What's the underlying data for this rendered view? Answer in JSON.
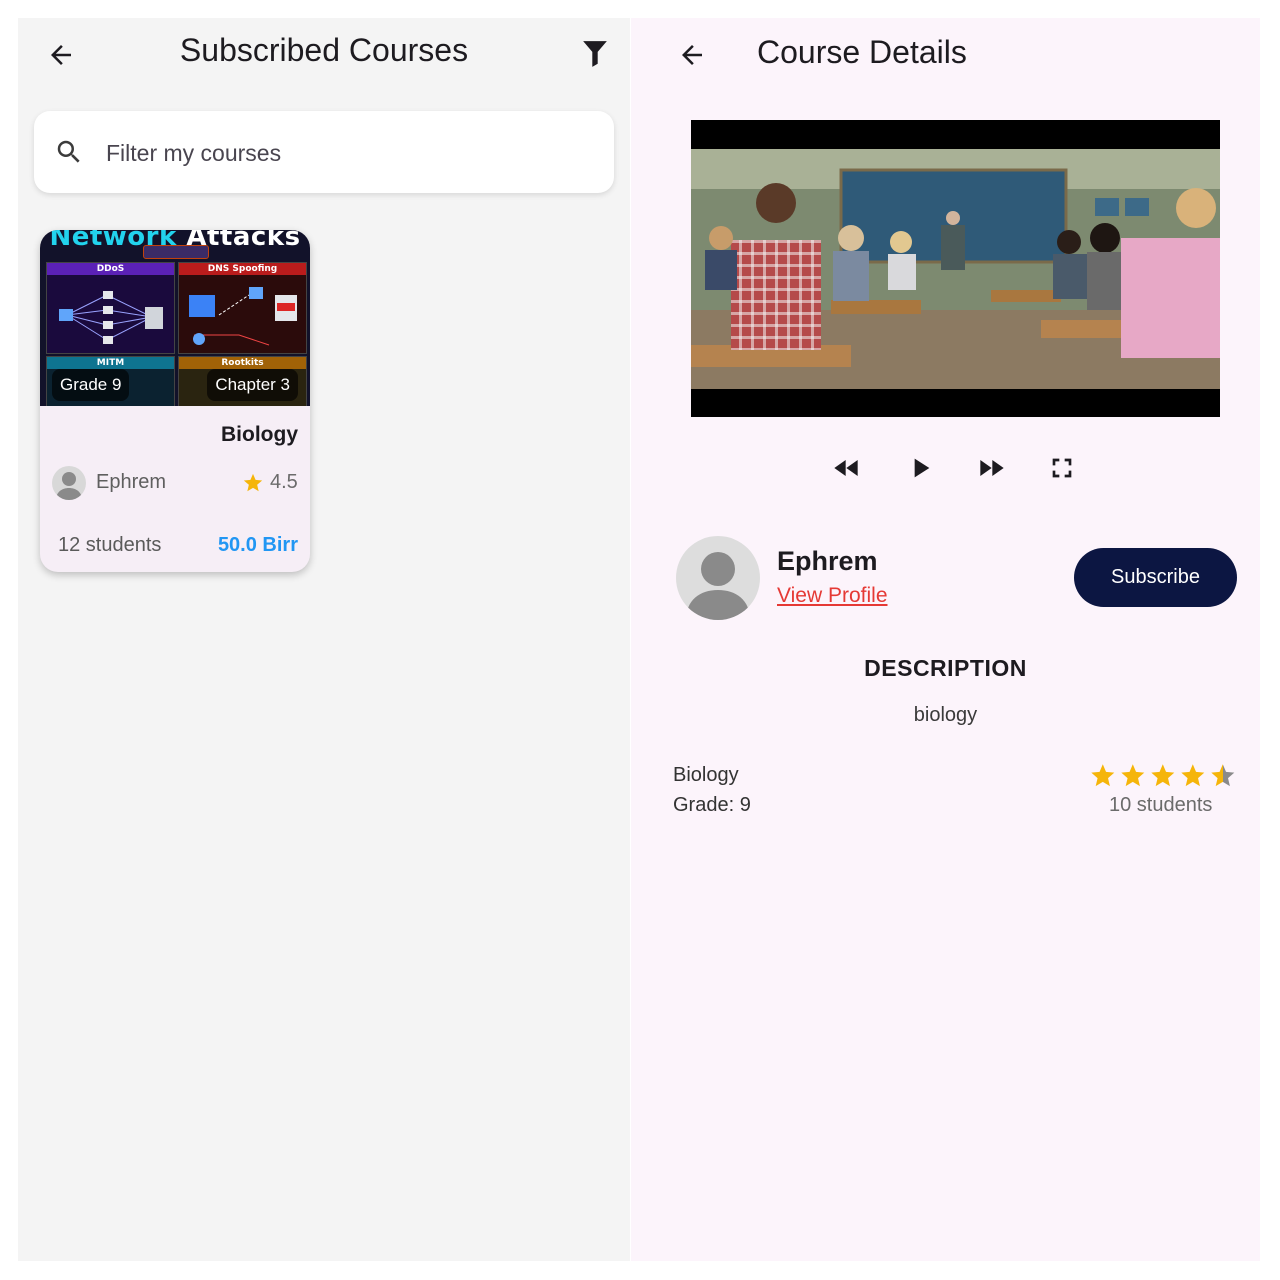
{
  "left": {
    "title": "Subscribed Courses",
    "search_placeholder": "Filter my courses",
    "course_card": {
      "thumbnail": {
        "title_part1": "Network",
        "title_part2": "Attacks",
        "panels": [
          "DDoS",
          "DNS Spoofing",
          "MITM",
          "Rootkits"
        ]
      },
      "grade_badge": "Grade 9",
      "chapter_badge": "Chapter 3",
      "subject": "Biology",
      "instructor": "Ephrem",
      "rating": "4.5",
      "students": "12 students",
      "price": "50.0 Birr"
    }
  },
  "right": {
    "title": "Course Details",
    "owner_name": "Ephrem",
    "view_profile": "View Profile",
    "subscribe_label": "Subscribe",
    "description_title": "DESCRIPTION",
    "description_text": "biology",
    "subject": "Biology",
    "grade": "Grade: 9",
    "rating_value": 4.5,
    "students": "10 students"
  },
  "colors": {
    "accent_blue": "#2196f3",
    "subscribe_bg": "#0c1642",
    "link_red": "#e53935",
    "star": "#f5b50a"
  },
  "icons": [
    "back-arrow-icon",
    "filter-icon",
    "search-icon",
    "star-icon",
    "rewind-icon",
    "play-icon",
    "fast-forward-icon",
    "fullscreen-icon",
    "person-icon"
  ]
}
